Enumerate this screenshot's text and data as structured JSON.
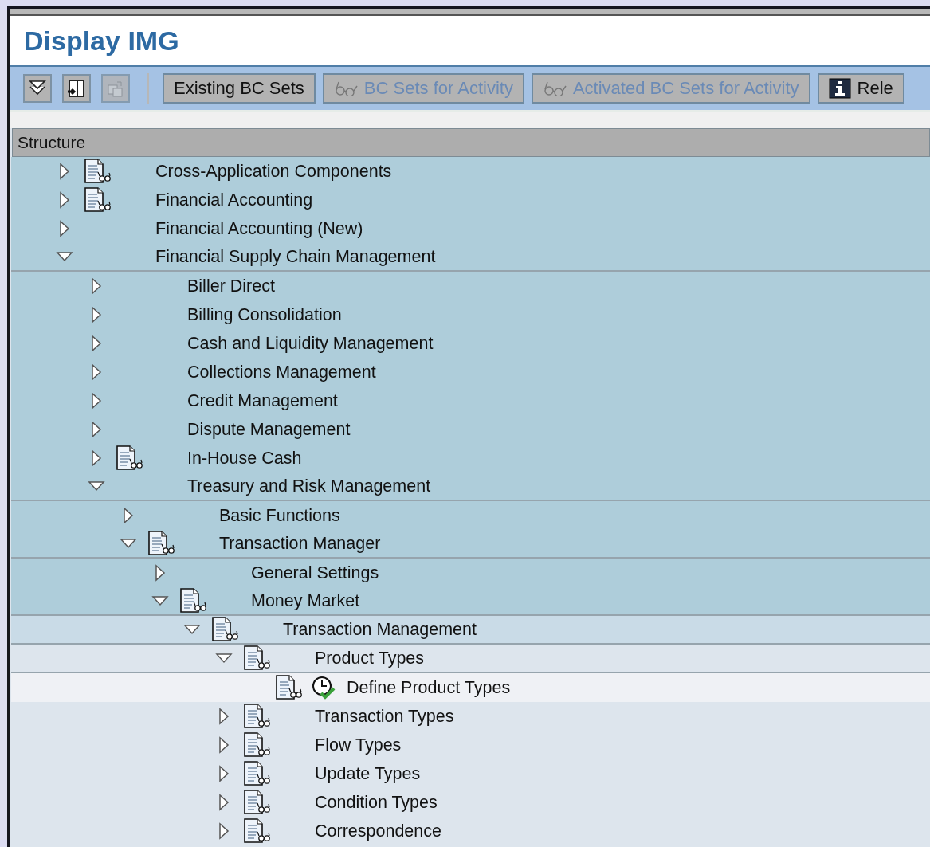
{
  "window": {
    "title": "Display IMG"
  },
  "toolbar": {
    "icon_buttons": [
      {
        "disabled": false
      },
      {
        "disabled": false
      },
      {
        "disabled": true
      }
    ],
    "buttons": [
      {
        "label": "Existing BC Sets",
        "disabled": false,
        "kind": "plain"
      },
      {
        "label": "BC Sets for Activity",
        "disabled": true,
        "kind": "glasses"
      },
      {
        "label": "Activated BC Sets for Activity",
        "disabled": true,
        "kind": "glasses"
      },
      {
        "label": "Rele",
        "disabled": false,
        "kind": "info"
      }
    ]
  },
  "tree": {
    "header": "Structure",
    "items": [
      {
        "label": "Cross-Application Components",
        "kind": "folder",
        "expanded": false,
        "document": true
      },
      {
        "label": "Financial Accounting",
        "kind": "folder",
        "expanded": false,
        "document": true
      },
      {
        "label": "Financial Accounting (New)",
        "kind": "folder",
        "expanded": false,
        "document": false
      },
      {
        "label": "Financial Supply Chain Management",
        "kind": "folder",
        "expanded": true,
        "document": false,
        "children": [
          {
            "label": "Biller Direct",
            "kind": "folder",
            "expanded": false,
            "document": false
          },
          {
            "label": "Billing Consolidation",
            "kind": "folder",
            "expanded": false,
            "document": false
          },
          {
            "label": "Cash and Liquidity Management",
            "kind": "folder",
            "expanded": false,
            "document": false
          },
          {
            "label": "Collections Management",
            "kind": "folder",
            "expanded": false,
            "document": false
          },
          {
            "label": "Credit Management",
            "kind": "folder",
            "expanded": false,
            "document": false
          },
          {
            "label": "Dispute Management",
            "kind": "folder",
            "expanded": false,
            "document": false
          },
          {
            "label": "In-House Cash",
            "kind": "folder",
            "expanded": false,
            "document": true
          },
          {
            "label": "Treasury and Risk Management",
            "kind": "folder",
            "expanded": true,
            "document": false,
            "children": [
              {
                "label": "Basic Functions",
                "kind": "folder",
                "expanded": false,
                "document": false
              },
              {
                "label": "Transaction Manager",
                "kind": "folder",
                "expanded": true,
                "document": true,
                "children": [
                  {
                    "label": "General Settings",
                    "kind": "folder",
                    "expanded": false,
                    "document": false
                  },
                  {
                    "label": "Money Market",
                    "kind": "folder",
                    "expanded": true,
                    "document": true,
                    "children": [
                      {
                        "label": "Transaction Management",
                        "kind": "folder",
                        "expanded": true,
                        "document": true,
                        "children": [
                          {
                            "label": "Product Types",
                            "kind": "folder",
                            "expanded": true,
                            "document": true,
                            "children": [
                              {
                                "label": "Define Product Types",
                                "kind": "activity",
                                "document": true
                              }
                            ]
                          },
                          {
                            "label": "Transaction Types",
                            "kind": "folder",
                            "expanded": false,
                            "document": true
                          },
                          {
                            "label": "Flow Types",
                            "kind": "folder",
                            "expanded": false,
                            "document": true
                          },
                          {
                            "label": "Update Types",
                            "kind": "folder",
                            "expanded": false,
                            "document": true
                          },
                          {
                            "label": "Condition Types",
                            "kind": "folder",
                            "expanded": false,
                            "document": true
                          },
                          {
                            "label": "Correspondence",
                            "kind": "folder",
                            "expanded": false,
                            "document": true
                          }
                        ]
                      }
                    ]
                  }
                ]
              }
            ]
          }
        ]
      }
    ]
  }
}
